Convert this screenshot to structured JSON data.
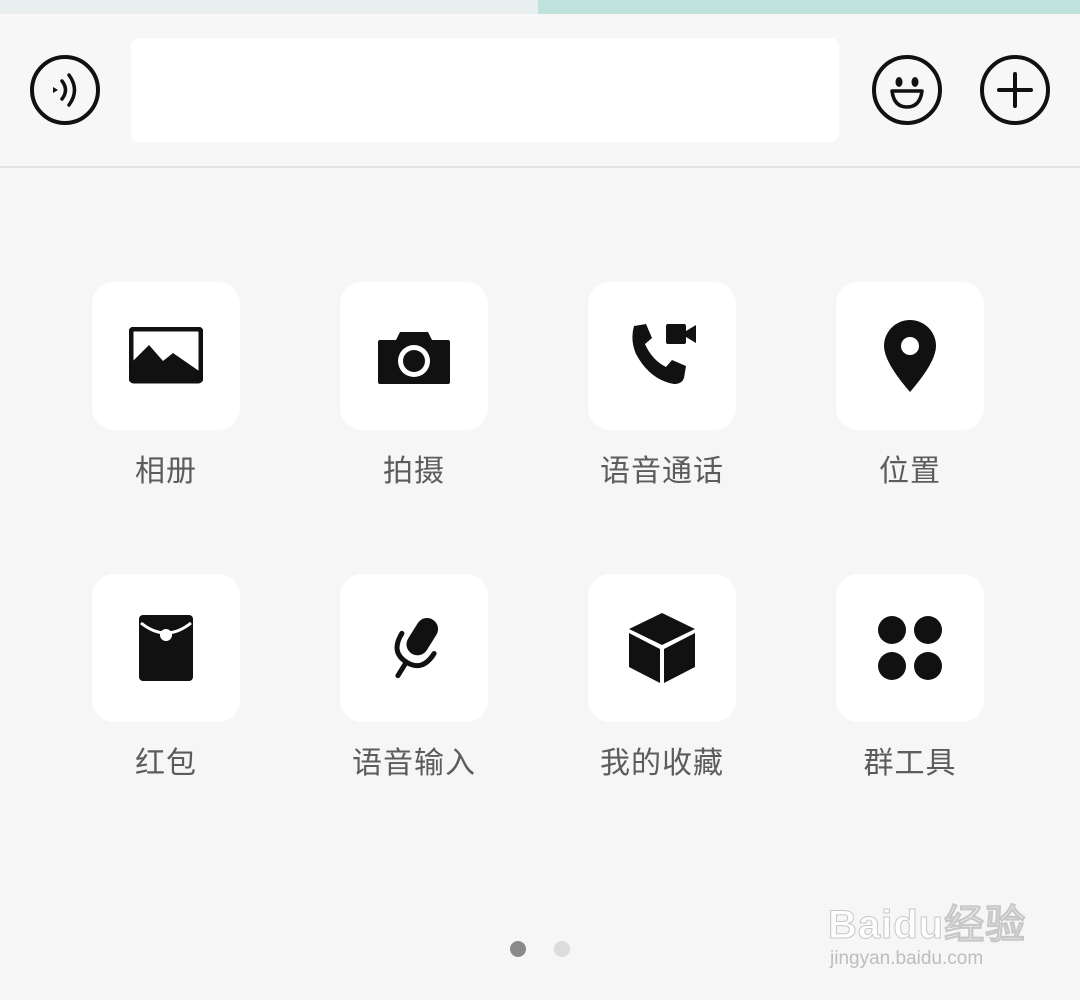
{
  "input_bar": {
    "voice_icon": "voice-wave-icon",
    "message_placeholder": "",
    "emoji_icon": "smiley-icon",
    "more_icon": "plus-icon"
  },
  "panel": {
    "items": [
      {
        "label": "相册",
        "icon": "image-icon"
      },
      {
        "label": "拍摄",
        "icon": "camera-icon"
      },
      {
        "label": "语音通话",
        "icon": "phone-video-icon"
      },
      {
        "label": "位置",
        "icon": "location-pin-icon"
      },
      {
        "label": "红包",
        "icon": "red-packet-icon"
      },
      {
        "label": "语音输入",
        "icon": "microphone-icon"
      },
      {
        "label": "我的收藏",
        "icon": "cube-icon"
      },
      {
        "label": "群工具",
        "icon": "four-dots-icon"
      }
    ],
    "pagination": {
      "pages": 2,
      "current": 1
    }
  },
  "watermark": {
    "brand": "Baidu经验",
    "url": "jingyan.baidu.com"
  }
}
